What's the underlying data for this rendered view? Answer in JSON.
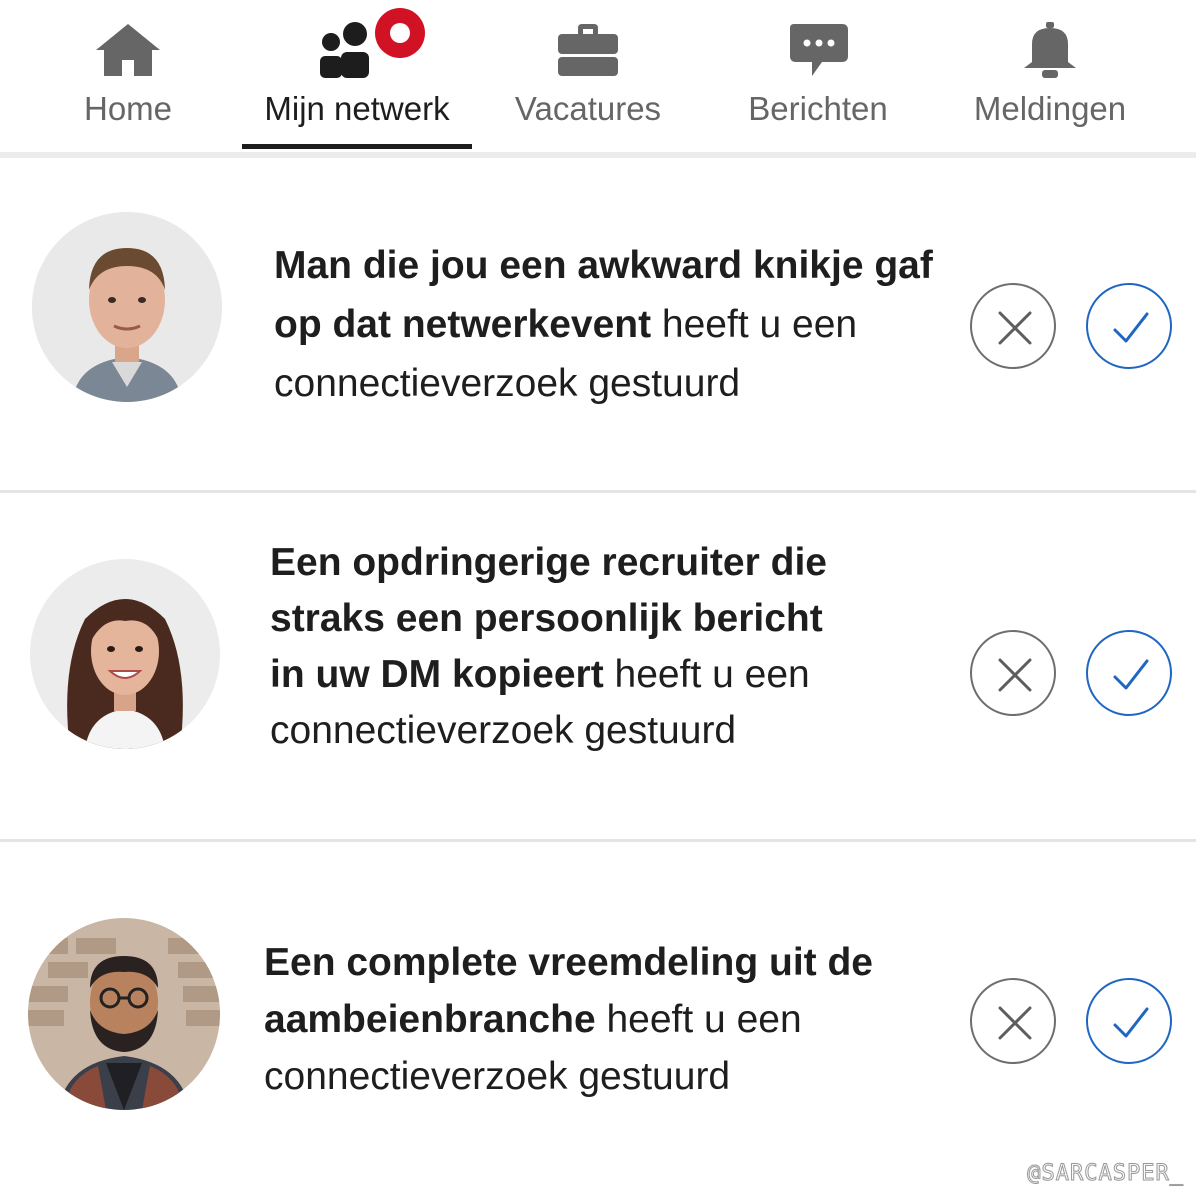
{
  "nav": {
    "items": [
      {
        "label": "Home",
        "icon": "home-icon"
      },
      {
        "label": "Mijn netwerk",
        "icon": "network-icon",
        "active": true,
        "badge": true
      },
      {
        "label": "Vacatures",
        "icon": "briefcase-icon"
      },
      {
        "label": "Berichten",
        "icon": "chat-icon"
      },
      {
        "label": "Meldingen",
        "icon": "bell-icon"
      }
    ]
  },
  "requests": [
    {
      "bold": "Man die jou een awkward knikje gaf op dat netwerkevent",
      "rest": " heeft u een connectieverzoek gestuurd",
      "avatar": "man-avatar"
    },
    {
      "bold": "Een opdringerige recruiter die straks een persoonlijk bericht in uw DM kopieert",
      "rest": " heeft u een connectieverzoek gestuurd",
      "avatar": "woman-avatar"
    },
    {
      "bold": "Een complete vreemdeling uit de aambeienbranche",
      "rest": " heeft u een connectieverzoek gestuurd",
      "avatar": "bearded-man-avatar"
    }
  ],
  "colors": {
    "accent": "#1f66c2",
    "badge": "#d11124",
    "icon_gray": "#666666"
  },
  "watermark": "@SARCASPER_"
}
